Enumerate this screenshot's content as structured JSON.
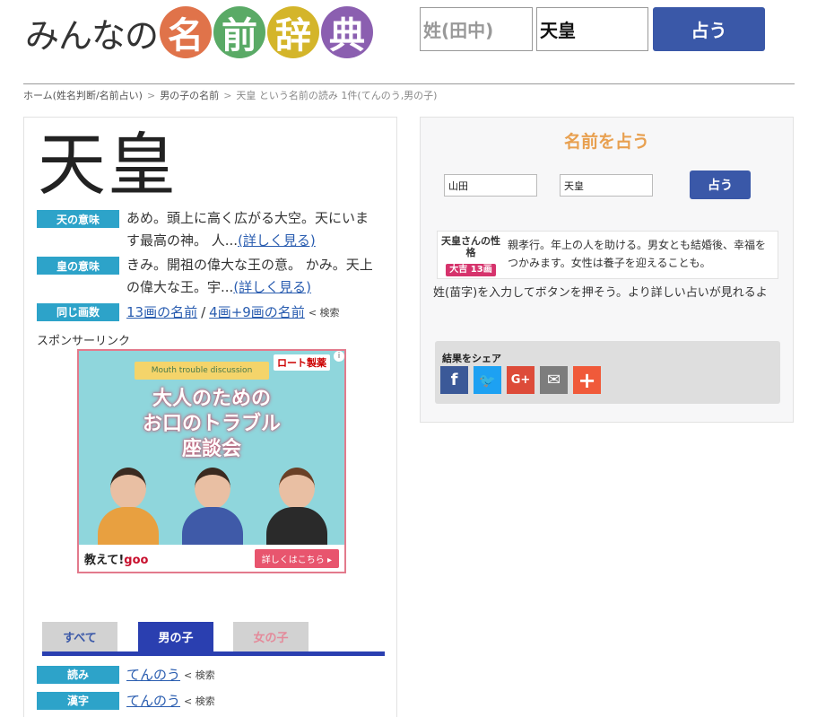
{
  "header": {
    "logo_prefix": "みんなの",
    "logo_chars": [
      {
        "char": "名",
        "color": "#e0734a"
      },
      {
        "char": "前",
        "color": "#5aaa66"
      },
      {
        "char": "辞",
        "color": "#d4b52a"
      },
      {
        "char": "典",
        "color": "#8b5fb0"
      }
    ],
    "last_name_placeholder": "姓(田中)",
    "first_name_value": "天皇",
    "submit_label": "占う"
  },
  "breadcrumb": {
    "home": "ホーム(姓名判断/名前占い)",
    "boys": "男の子の名前",
    "current": "天皇 という名前の読み 1件(てんのう,男の子)"
  },
  "name": {
    "kanji": "天皇",
    "meaning1_label": "天の意味",
    "meaning1_text": "あめ。頭上に高く広がる大空。天にいます最高の神。 人...",
    "meaning1_link": "(詳しく見る)",
    "meaning2_label": "皇の意味",
    "meaning2_text": "きみ。開祖の偉大な王の意。 かみ。天上の偉大な王。宇...",
    "meaning2_link": "(詳しく見る)",
    "same_strokes_label": "同じ画数",
    "strokes_link1": "13画の名前",
    "strokes_sep": "/",
    "strokes_link2": "4画+9画の名前",
    "search_suffix": "< 検索"
  },
  "sponsor_label": "スポンサーリンク",
  "ad": {
    "ribbon": "Mouth trouble discussion",
    "brand": "ロート製薬",
    "info": "i",
    "title_line1": "大人のための",
    "title_line2": "お口のトラブル",
    "title_line3": "座談会",
    "footer_left": "教えて!",
    "footer_goo": "goo",
    "more": "詳しくはこちら ▸"
  },
  "tabs": {
    "all": "すべて",
    "boy": "男の子",
    "girl": "女の子"
  },
  "results": {
    "reading_label": "読み",
    "reading_value": "てんのう",
    "kanji_label": "漢字",
    "kanji_value": "てんのう",
    "search_suffix": "< 検索"
  },
  "fortune": {
    "title": "名前を占う",
    "last_name_value": "山田",
    "first_name_value": "天皇",
    "submit_label": "占う",
    "persona_name": "天皇さんの性格",
    "persona_rank": "大吉 13画",
    "persona_text": "親孝行。年上の人を助ける。男女とも結婚後、幸福をつかみます。女性は養子を迎えることも。",
    "hint": "姓(苗字)を入力してボタンを押そう。より詳しい占いが見れるよ",
    "share_label": "結果をシェア",
    "share_buttons": [
      {
        "icon": "facebook-icon",
        "glyph": "f",
        "color": "#3b5998"
      },
      {
        "icon": "twitter-icon",
        "glyph": "🐦",
        "color": "#1da1f2"
      },
      {
        "icon": "google-plus-icon",
        "glyph": "G+",
        "color": "#dd4b39"
      },
      {
        "icon": "email-icon",
        "glyph": "✉",
        "color": "#7d7d7d"
      },
      {
        "icon": "more-share-icon",
        "glyph": "+",
        "color": "#f05a3a"
      }
    ]
  }
}
